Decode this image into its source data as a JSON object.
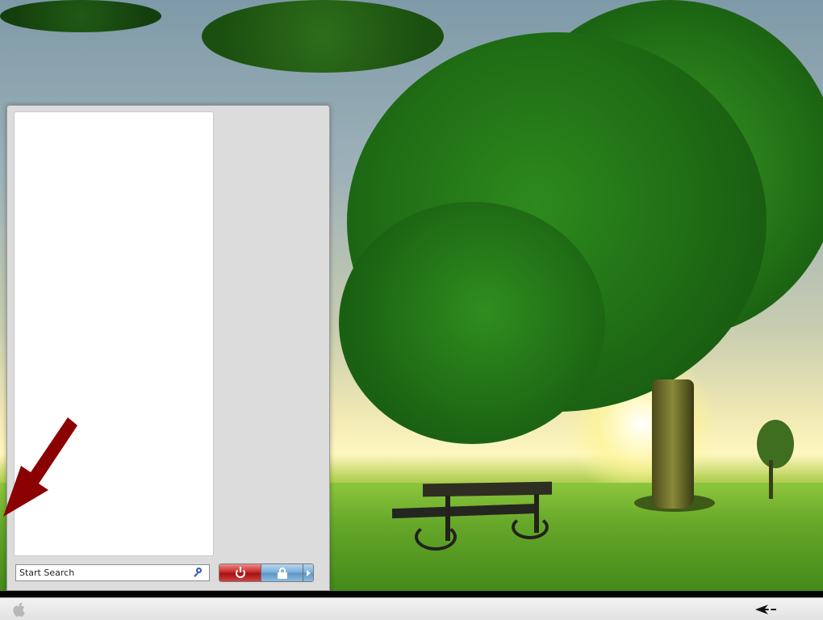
{
  "start_menu": {
    "search": {
      "placeholder": "Start Search"
    },
    "power_buttons": {
      "power": "power-icon",
      "lock": "lock-icon",
      "more": "chevron-right-icon"
    }
  },
  "taskbar": {
    "start_button": "apple-logo-icon",
    "tray_icon": "arrow-left-icon"
  },
  "colors": {
    "annotation_arrow": "#8b0000",
    "power_button": "#c82a2a",
    "lock_button": "#7fb0d8",
    "taskbar": "#e8e8e8"
  }
}
